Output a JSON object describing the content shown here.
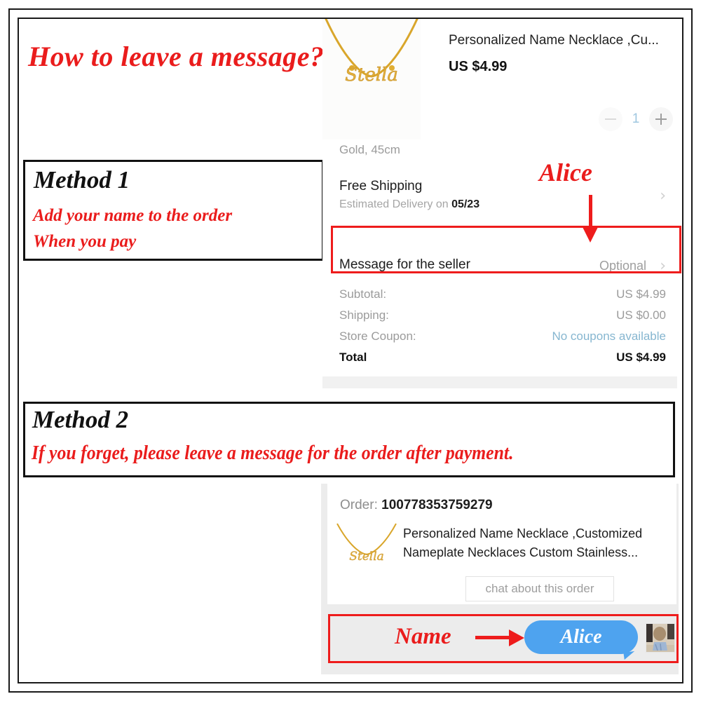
{
  "headline": "How to leave a message?",
  "method1": {
    "title": "Method 1",
    "line1": "Add your name to the order",
    "line2": "When you pay"
  },
  "method2": {
    "title": "Method 2",
    "line1": "If you forget, please leave a message for the order after payment."
  },
  "checkout": {
    "product_title": "Personalized Name Necklace ,Cu...",
    "price": "US $4.99",
    "quantity": "1",
    "minus_label": "-",
    "plus_label": "+",
    "variant": "Gold, 45cm",
    "shipping_title": "Free Shipping",
    "shipping_estimate_prefix": "Estimated Delivery on ",
    "shipping_estimate_date": "05/23",
    "message_label": "Message for the seller",
    "message_placeholder": "Optional",
    "chevron": "›",
    "totals": [
      {
        "label": "Subtotal:",
        "value": "US $4.99",
        "kind": "muted"
      },
      {
        "label": "Shipping:",
        "value": "US $0.00",
        "kind": "muted"
      },
      {
        "label": "Store Coupon:",
        "value": "No coupons available",
        "kind": "coupon"
      },
      {
        "label": "Total",
        "value": "US $4.99",
        "kind": "total"
      }
    ],
    "necklace_name": "Stella"
  },
  "annotations": {
    "alice": "Alice",
    "name": "Name"
  },
  "order": {
    "order_label": "Order: ",
    "order_number": "100778353759279",
    "description": "Personalized Name Necklace ,Customized Nameplate Necklaces Custom Stainless...",
    "chat_button": "chat about this order",
    "necklace_name": "Stella"
  },
  "chat": {
    "bubble_text": "Alice"
  },
  "colors": {
    "annotation_red": "#ea1c1c",
    "box_red": "#ee1c1c",
    "bubble_blue": "#4ea3ef",
    "coupon_blue": "#86b6d0",
    "panel_gray": "#ececec",
    "band_gray": "#f1f1f1"
  }
}
